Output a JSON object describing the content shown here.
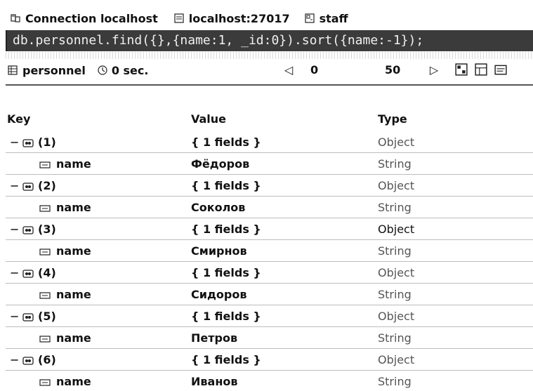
{
  "connection": {
    "label": "Connection localhost",
    "host": "localhost:27017",
    "db": "staff"
  },
  "query": {
    "text": "db.personnel.find({},{name:1, _id:0}).sort({name:-1});"
  },
  "toolbar": {
    "collection": "personnel",
    "time": "0 sec.",
    "skip": "0",
    "limit": "50"
  },
  "table": {
    "headers": {
      "key": "Key",
      "value": "Value",
      "type": "Type"
    },
    "rows": [
      {
        "key": "(1)",
        "value": "{ 1 fields }",
        "type": "Object"
      },
      {
        "key": "name",
        "value": "Фёдоров",
        "type": "String"
      },
      {
        "key": "(2)",
        "value": "{ 1 fields }",
        "type": "Object"
      },
      {
        "key": "name",
        "value": "Соколов",
        "type": "String"
      },
      {
        "key": "(3)",
        "value": "{ 1 fields }",
        "type": "Object"
      },
      {
        "key": "name",
        "value": "Смирнов",
        "type": "String"
      },
      {
        "key": "(4)",
        "value": "{ 1 fields }",
        "type": "Object"
      },
      {
        "key": "name",
        "value": "Сидоров",
        "type": "String"
      },
      {
        "key": "(5)",
        "value": "{ 1 fields }",
        "type": "Object"
      },
      {
        "key": "name",
        "value": "Петров",
        "type": "String"
      },
      {
        "key": "(6)",
        "value": "{ 1 fields }",
        "type": "Object"
      },
      {
        "key": "name",
        "value": "Иванов",
        "type": "String"
      }
    ]
  },
  "icons": {
    "connection": "connection-icon",
    "server": "server-icon",
    "database": "database-icon",
    "collection": "collection-icon",
    "timer": "clock-icon",
    "expand": "expand-icon",
    "object": "object-icon",
    "string": "string-icon",
    "prev": "prev-page-icon",
    "next": "next-page-icon",
    "view": "view-icon"
  }
}
